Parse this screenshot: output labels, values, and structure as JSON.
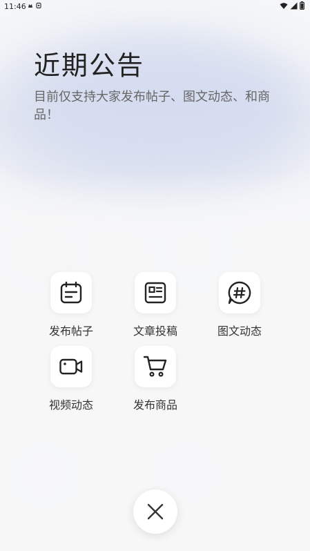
{
  "status_bar": {
    "time": "11:46"
  },
  "announcement": {
    "title": "近期公告",
    "text": "目前仅支持大家发布帖子、图文动态、和商品！"
  },
  "actions": [
    {
      "label": "发布帖子",
      "icon": "calendar-note-icon"
    },
    {
      "label": "文章投稿",
      "icon": "article-icon"
    },
    {
      "label": "图文动态",
      "icon": "hashtag-chat-icon"
    },
    {
      "label": "视频动态",
      "icon": "video-camera-icon"
    },
    {
      "label": "发布商品",
      "icon": "shopping-cart-icon"
    }
  ],
  "close_icon": "close-icon"
}
